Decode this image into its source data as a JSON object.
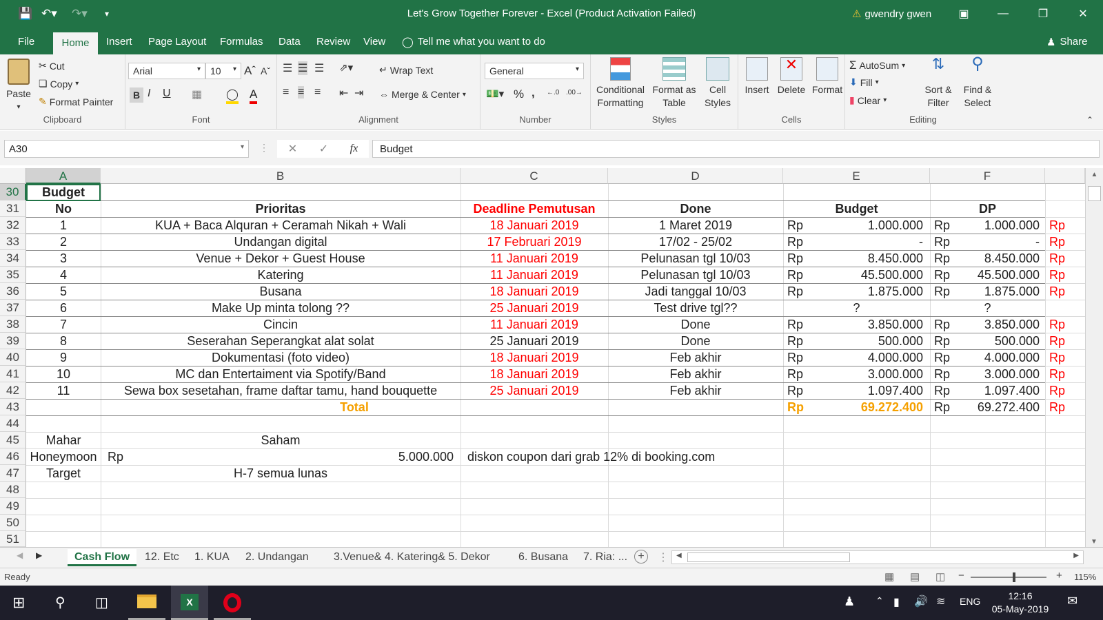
{
  "title_bar": {
    "title": "Let's Grow Together Forever - Excel (Product Activation Failed)",
    "user": "gwendry gwen",
    "warning_icon": "warning-triangle-icon"
  },
  "ribbon_tabs": [
    "File",
    "Home",
    "Insert",
    "Page Layout",
    "Formulas",
    "Data",
    "Review",
    "View"
  ],
  "tell_me": "Tell me what you want to do",
  "share": "Share",
  "clipboard": {
    "paste": "Paste",
    "cut": "Cut",
    "copy": "Copy",
    "format_painter": "Format Painter",
    "label": "Clipboard"
  },
  "font": {
    "name": "Arial",
    "size": "10",
    "label": "Font",
    "bold": "B",
    "italic": "I",
    "underline": "U"
  },
  "alignment": {
    "wrap_text": "Wrap Text",
    "merge_center": "Merge & Center",
    "label": "Alignment"
  },
  "number": {
    "format": "General",
    "percent": "%",
    "comma": ",",
    "label": "Number"
  },
  "styles": {
    "conditional_1": "Conditional",
    "conditional_2": "Formatting",
    "format_table_1": "Format as",
    "format_table_2": "Table",
    "cell_styles_1": "Cell",
    "cell_styles_2": "Styles",
    "label": "Styles"
  },
  "cells": {
    "insert": "Insert",
    "delete": "Delete",
    "format": "Format",
    "label": "Cells"
  },
  "editing": {
    "autosum": "AutoSum",
    "fill": "Fill",
    "clear": "Clear",
    "sort_1": "Sort &",
    "sort_2": "Filter",
    "find_1": "Find &",
    "find_2": "Select",
    "label": "Editing"
  },
  "formula_bar": {
    "name_box": "A30",
    "fx": "fx",
    "content": "Budget"
  },
  "columns": [
    "A",
    "B",
    "C",
    "D",
    "E",
    "F"
  ],
  "rows": [
    "30",
    "31",
    "32",
    "33",
    "34",
    "35",
    "36",
    "37",
    "38",
    "39",
    "40",
    "41",
    "42",
    "43",
    "44",
    "45",
    "46",
    "47",
    "48",
    "49",
    "50",
    "51"
  ],
  "sheet": {
    "section_title": "Budget",
    "headers": {
      "no": "No",
      "prioritas": "Prioritas",
      "deadline": "Deadline Pemutusan",
      "done": "Done",
      "budget": "Budget",
      "dp": "DP"
    },
    "items": [
      {
        "no": "1",
        "prioritas": "KUA + Baca Alquran + Ceramah Nikah + Wali",
        "deadline": "18 Januari 2019",
        "deadline_red": true,
        "done": "1 Maret 2019",
        "budget_rp": "Rp",
        "budget": "1.000.000",
        "dp_rp": "Rp",
        "dp": "1.000.000",
        "g_rp": "Rp"
      },
      {
        "no": "2",
        "prioritas": "Undangan digital",
        "deadline": "17 Februari 2019",
        "deadline_red": true,
        "done": "17/02 - 25/02",
        "budget_rp": "Rp",
        "budget": "-",
        "dp_rp": "Rp",
        "dp": "-",
        "g_rp": "Rp"
      },
      {
        "no": "3",
        "prioritas": "Venue + Dekor + Guest House",
        "deadline": "11 Januari 2019",
        "deadline_red": true,
        "done": "Pelunasan tgl 10/03",
        "budget_rp": "Rp",
        "budget": "8.450.000",
        "dp_rp": "Rp",
        "dp": "8.450.000",
        "g_rp": "Rp"
      },
      {
        "no": "4",
        "prioritas": "Katering",
        "deadline": "11 Januari 2019",
        "deadline_red": true,
        "done": "Pelunasan tgl 10/03",
        "budget_rp": "Rp",
        "budget": "45.500.000",
        "dp_rp": "Rp",
        "dp": "45.500.000",
        "g_rp": "Rp"
      },
      {
        "no": "5",
        "prioritas": "Busana",
        "deadline": "18 Januari 2019",
        "deadline_red": true,
        "done": "Jadi tanggal 10/03",
        "budget_rp": "Rp",
        "budget": "1.875.000",
        "dp_rp": "Rp",
        "dp": "1.875.000",
        "g_rp": "Rp"
      },
      {
        "no": "6",
        "prioritas": "Make Up minta tolong ??",
        "deadline": "25 Januari 2019",
        "deadline_red": true,
        "done": "Test drive tgl??",
        "budget_rp": "",
        "budget": "?",
        "dp_rp": "",
        "dp": "?",
        "g_rp": ""
      },
      {
        "no": "7",
        "prioritas": "Cincin",
        "deadline": "11 Januari 2019",
        "deadline_red": true,
        "done": "Done",
        "budget_rp": "Rp",
        "budget": "3.850.000",
        "dp_rp": "Rp",
        "dp": "3.850.000",
        "g_rp": "Rp"
      },
      {
        "no": "8",
        "prioritas": "Seserahan Seperangkat alat solat",
        "deadline": "25 Januari 2019",
        "deadline_red": false,
        "done": "Done",
        "budget_rp": "Rp",
        "budget": "500.000",
        "dp_rp": "Rp",
        "dp": "500.000",
        "g_rp": "Rp"
      },
      {
        "no": "9",
        "prioritas": "Dokumentasi (foto video)",
        "deadline": "18 Januari 2019",
        "deadline_red": true,
        "done": "Feb akhir",
        "budget_rp": "Rp",
        "budget": "4.000.000",
        "dp_rp": "Rp",
        "dp": "4.000.000",
        "g_rp": "Rp"
      },
      {
        "no": "10",
        "prioritas": "MC dan Entertaiment via Spotify/Band",
        "deadline": "18 Januari 2019",
        "deadline_red": true,
        "done": "Feb akhir",
        "budget_rp": "Rp",
        "budget": "3.000.000",
        "dp_rp": "Rp",
        "dp": "3.000.000",
        "g_rp": "Rp"
      },
      {
        "no": "11",
        "prioritas": "Sewa box sesetahan, frame daftar tamu, hand bouquette",
        "deadline": "25 Januari 2019",
        "deadline_red": true,
        "done": "Feb akhir",
        "budget_rp": "Rp",
        "budget": "1.097.400",
        "dp_rp": "Rp",
        "dp": "1.097.400",
        "g_rp": "Rp"
      }
    ],
    "total": {
      "label": "Total",
      "budget_rp": "Rp",
      "budget": "69.272.400",
      "dp_rp": "Rp",
      "dp": "69.272.400",
      "g_rp": "Rp"
    },
    "mahar": {
      "label": "Mahar",
      "value": "Saham"
    },
    "honeymoon": {
      "label": "Honeymoon",
      "rp": "Rp",
      "value": "5.000.000",
      "note": "diskon coupon dari grab 12% di booking.com"
    },
    "target": {
      "label": "Target",
      "value": "H-7 semua lunas"
    }
  },
  "sheet_tabs": [
    "Cash Flow",
    "12. Etc",
    "1. KUA",
    "2. Undangan",
    "3.Venue& 4. Katering& 5. Dekor",
    "6. Busana",
    "7. Ria: ..."
  ],
  "status": {
    "ready": "Ready",
    "zoom": "115%"
  },
  "taskbar": {
    "lang": "ENG",
    "time": "12:16",
    "date": "05-May-2019"
  },
  "colors": {
    "excel_green": "#217346",
    "red": "#ff0000",
    "orange": "#f5a000"
  }
}
